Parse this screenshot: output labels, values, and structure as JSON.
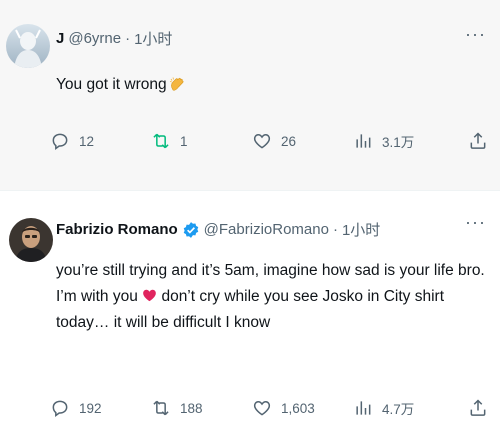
{
  "tweets": [
    {
      "name": "J",
      "handle": "@6yrne",
      "dot": "·",
      "time": "1小时",
      "more": "···",
      "text": "You got it wrong",
      "emoji": "clapping-hands",
      "stats": {
        "replies": "12",
        "retweets": "1",
        "likes": "26",
        "views": "3.1万"
      },
      "colors": {
        "retweet": "#00ba7c",
        "background": "#f7f7f7"
      }
    },
    {
      "name": "Fabrizio Romano",
      "verified": true,
      "handle": "@FabrizioRomano",
      "dot": "·",
      "time": "1小时",
      "more": "···",
      "text_before_emoji": "you’re still trying and it’s 5am, imagine how sad is your life bro. I’m with you ",
      "text_after_emoji": " don’t cry while you see Josko in City shirt today… it will be difficult I know",
      "emoji": "red-heart",
      "stats": {
        "replies": "192",
        "retweets": "188",
        "likes": "1,603",
        "views": "4.7万"
      },
      "colors": {
        "verified": "#1d9bf0",
        "heart": "#e0245e"
      }
    }
  ]
}
